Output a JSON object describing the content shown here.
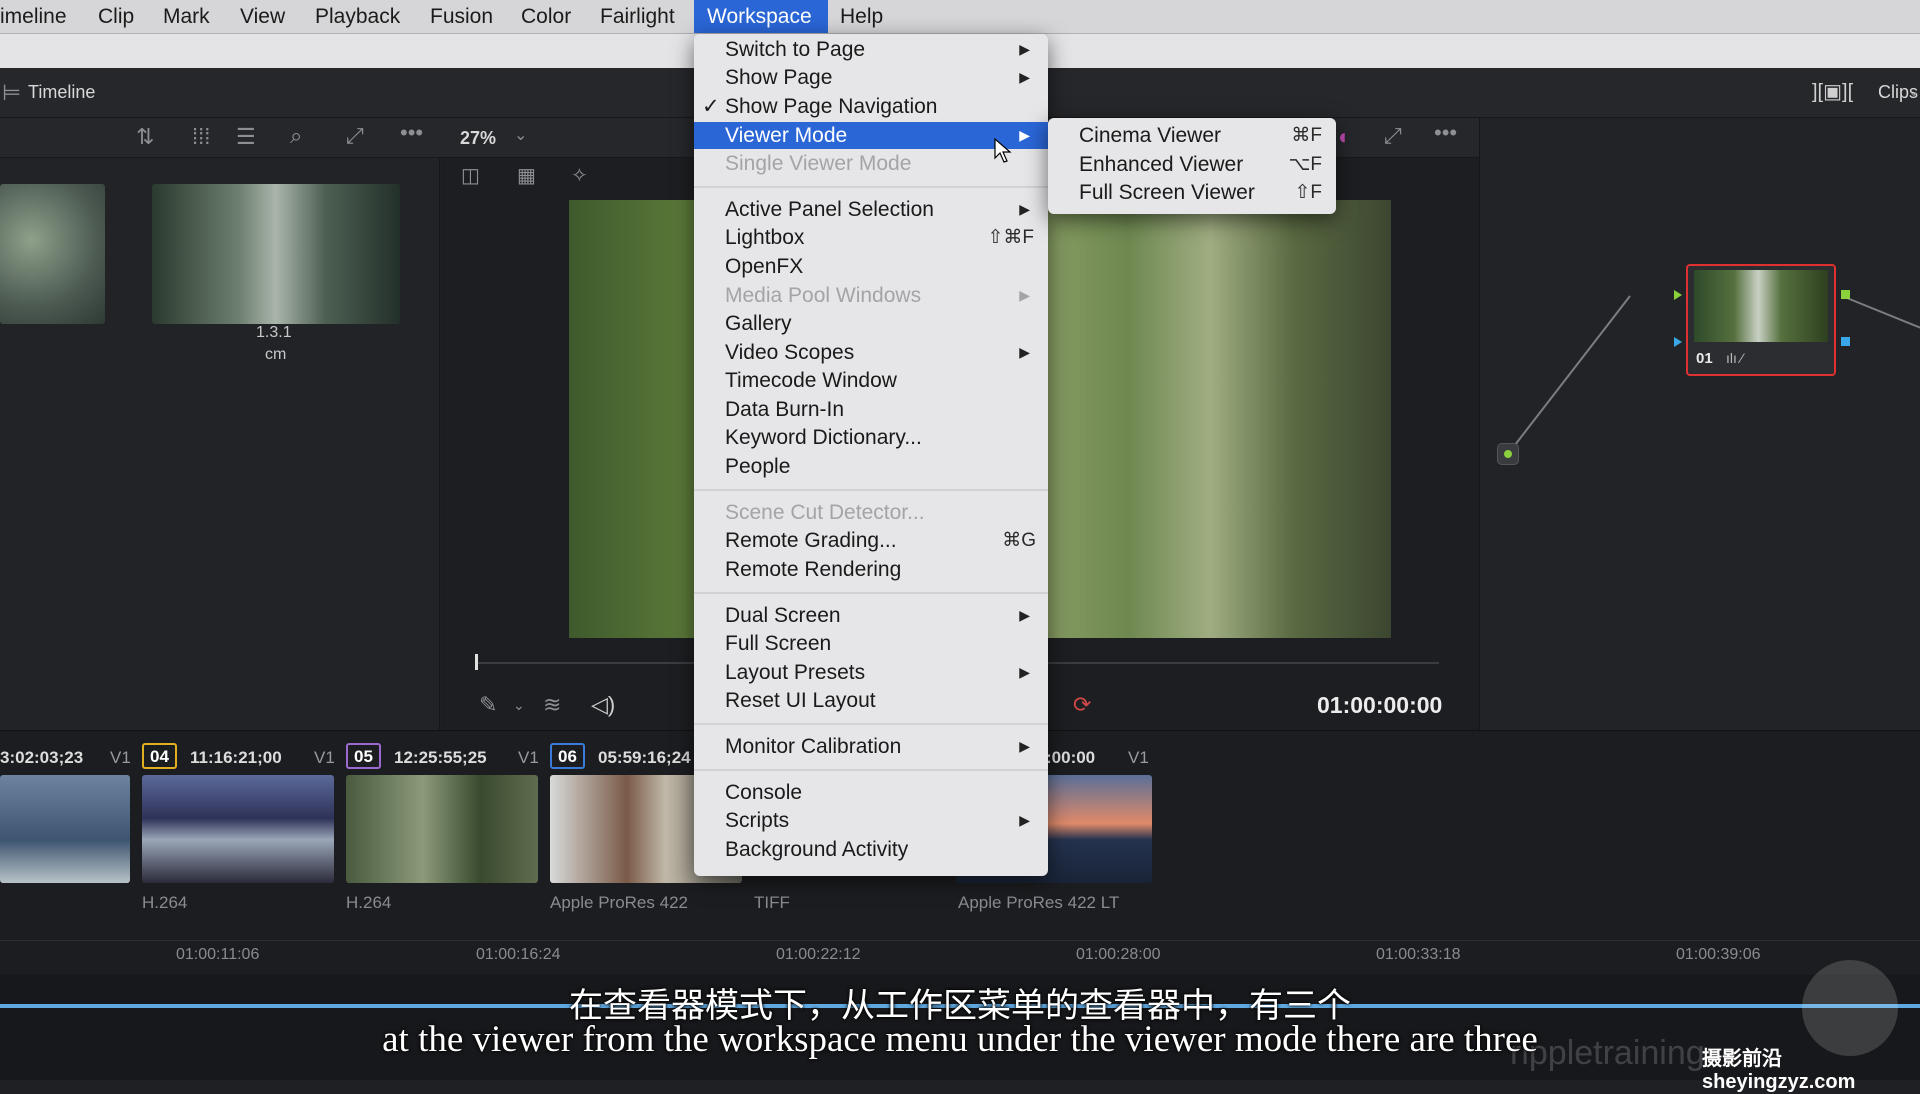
{
  "menubar": [
    "imeline",
    "Clip",
    "Mark",
    "View",
    "Playback",
    "Fusion",
    "Color",
    "Fairlight",
    "Workspace",
    "Help"
  ],
  "panel": {
    "title": "Timeline",
    "zoom": "27%",
    "clips_label": "Clips"
  },
  "mediapool": {
    "clip_name": "1.3.1",
    "clip_sub": "cm"
  },
  "viewer": {
    "timecode": "01:00:00:00"
  },
  "node": {
    "label": "01"
  },
  "workspace_menu": [
    {
      "label": "Switch to Page",
      "sub": true
    },
    {
      "label": "Show Page",
      "sub": true
    },
    {
      "label": "Show Page Navigation",
      "checked": true
    },
    {
      "label": "Viewer Mode",
      "sub": true,
      "highlighted": true
    },
    {
      "label": "Single Viewer Mode",
      "disabled": true
    },
    {
      "label": "Active Panel Selection",
      "sub": true
    },
    {
      "label": "Lightbox",
      "shortcut": "⇧⌘F"
    },
    {
      "label": "OpenFX"
    },
    {
      "label": "Media Pool Windows",
      "sub": true,
      "disabled": true
    },
    {
      "label": "Gallery"
    },
    {
      "label": "Video Scopes",
      "sub": true
    },
    {
      "label": "Timecode Window"
    },
    {
      "label": "Data Burn-In"
    },
    {
      "label": "Keyword Dictionary..."
    },
    {
      "label": "People"
    },
    {
      "label": "Scene Cut Detector...",
      "disabled": true
    },
    {
      "label": "Remote Grading...",
      "shortcut": "⌘G"
    },
    {
      "label": "Remote Rendering"
    },
    {
      "label": "Dual Screen",
      "sub": true
    },
    {
      "label": "Full Screen"
    },
    {
      "label": "Layout Presets",
      "sub": true
    },
    {
      "label": "Reset UI Layout"
    },
    {
      "label": "Monitor Calibration",
      "sub": true
    },
    {
      "label": "Console"
    },
    {
      "label": "Scripts",
      "sub": true
    },
    {
      "label": "Background Activity"
    }
  ],
  "viewer_submenu": [
    {
      "label": "Cinema Viewer",
      "shortcut": "⌘F"
    },
    {
      "label": "Enhanced Viewer",
      "shortcut": "⌥F"
    },
    {
      "label": "Full Screen Viewer",
      "shortcut": "⇧F"
    }
  ],
  "clips": {
    "tc0": "3:02:03;23",
    "track": "V1",
    "items": [
      {
        "num": "04",
        "tc": "11:16:21;00",
        "codec": "H.264"
      },
      {
        "num": "05",
        "tc": "12:25:55;25",
        "codec": "H.264"
      },
      {
        "num": "06",
        "tc": "05:59:16;24",
        "codec": "Apple ProRes 422"
      }
    ],
    "tc_last": ":00:00",
    "codec_tiff": "TIFF",
    "codec_last": "Apple ProRes 422 LT"
  },
  "ruler": [
    "01:00:11:06",
    "01:00:16:24",
    "01:00:22:12",
    "01:00:28:00",
    "01:00:33:18",
    "01:00:39:06"
  ],
  "subtitles": {
    "zh": "在查看器模式下，从工作区菜单的查看器中，有三个",
    "en": "at the viewer from the workspace menu under the viewer mode there are three"
  },
  "watermark": {
    "brand": "rippletraining",
    "site": "摄影前沿sheyingzyz.com"
  },
  "colors": {
    "highlight": "#2a66d6",
    "badge04": "#e0b020",
    "badge05": "#9a6ad0",
    "badge06": "#3a7ad8",
    "node_border": "#e03030"
  }
}
